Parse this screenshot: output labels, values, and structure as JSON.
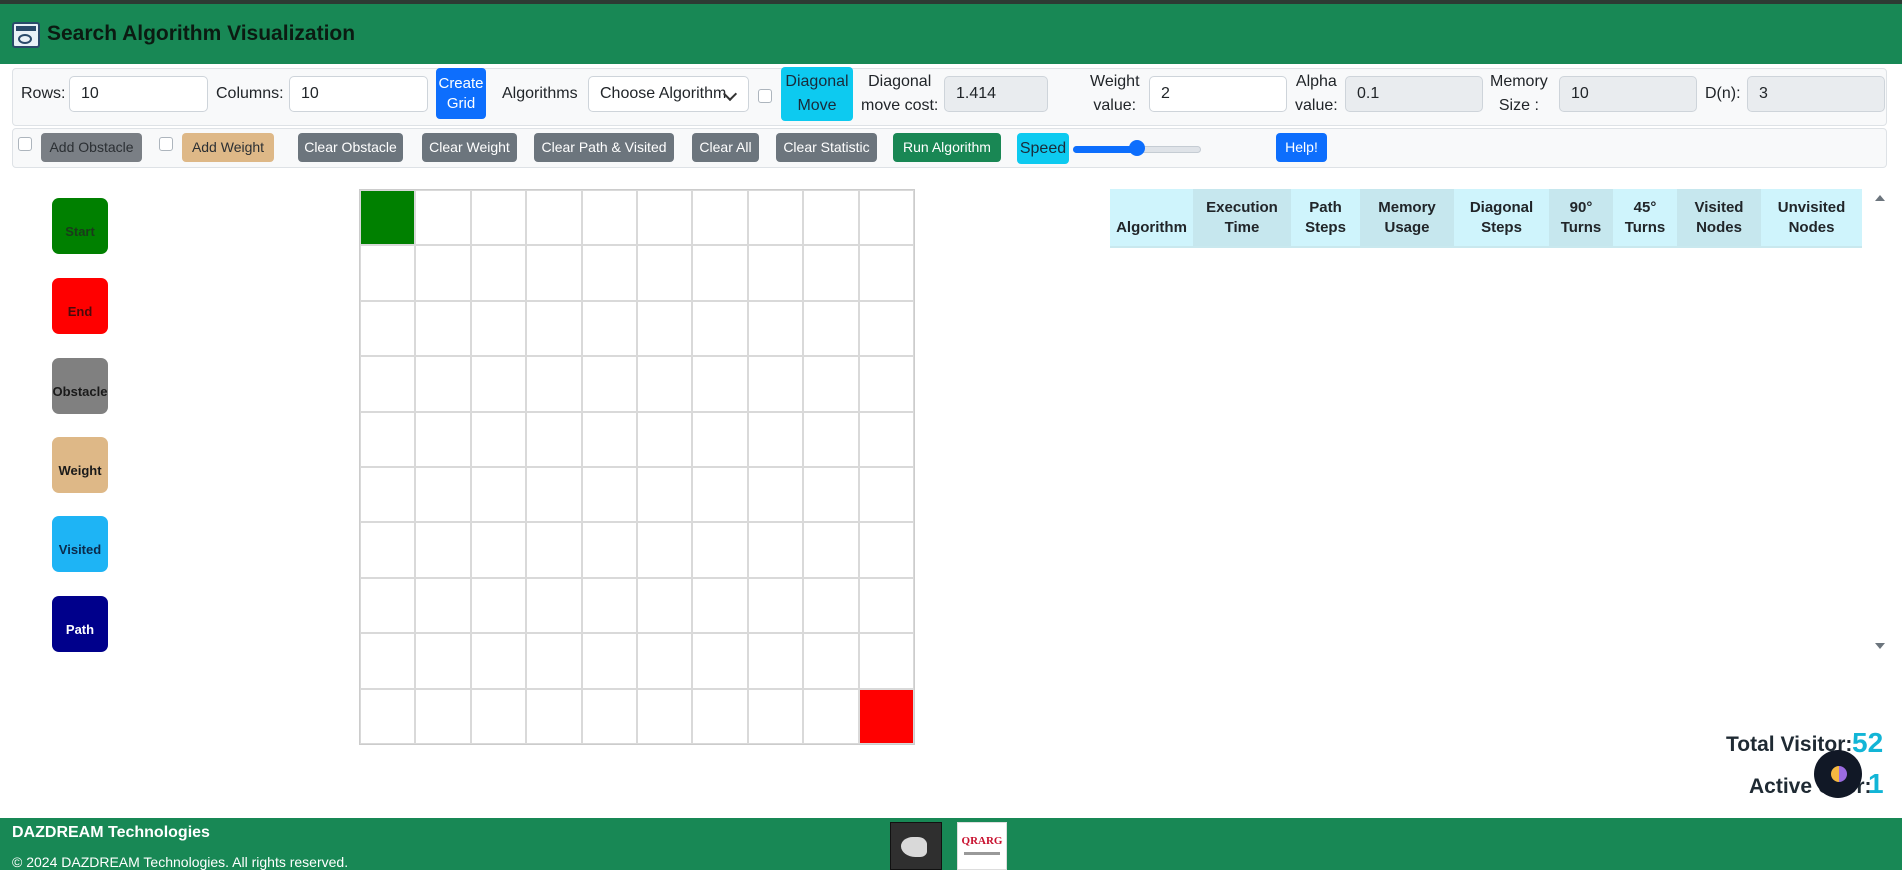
{
  "header": {
    "title": "Search Algorithm Visualization",
    "logo_icon": "app-logo-icon"
  },
  "controls": {
    "rows_label": "Rows:",
    "rows_value": "10",
    "columns_label": "Columns:",
    "columns_value": "10",
    "create_grid_line1": "Create",
    "create_grid_line2": "Grid",
    "algorithms_label": "Algorithms",
    "algorithm_selected": "Choose Algorithm",
    "diagonal_move_line1": "Diagonal",
    "diagonal_move_line2": "Move",
    "diagonal_cost_line1": "Diagonal",
    "diagonal_cost_line2": "move cost:",
    "diagonal_cost_value": "1.414",
    "weight_line1": "Weight",
    "weight_line2": "value:",
    "weight_value": "2",
    "alpha_line1": "Alpha",
    "alpha_line2": "value:",
    "alpha_value": "0.1",
    "memory_line1": "Memory",
    "memory_line2": "Size :",
    "memory_value": "10",
    "dn_label": "D(n):",
    "dn_value": "3"
  },
  "actions": {
    "add_obstacle": "Add Obstacle",
    "add_weight": "Add Weight",
    "clear_obstacle": "Clear Obstacle",
    "clear_weight": "Clear Weight",
    "clear_path_visited": "Clear Path & Visited",
    "clear_all": "Clear All",
    "clear_statistic": "Clear Statistic",
    "run_algorithm": "Run Algorithm",
    "speed_label": "Speed",
    "speed_level": 0.5,
    "help": "Help!"
  },
  "legend": [
    {
      "label": "Start",
      "color": "#008000"
    },
    {
      "label": "End",
      "color": "#ff0000"
    },
    {
      "label": "Obstacle",
      "color": "#808080"
    },
    {
      "label": "Weight",
      "color": "#deb887"
    },
    {
      "label": "Visited",
      "color": "#1eb4f5"
    },
    {
      "label": "Path",
      "color": "#00008b"
    }
  ],
  "grid": {
    "rows": 10,
    "columns": 10,
    "start": [
      0,
      0
    ],
    "end": [
      9,
      9
    ]
  },
  "stats_table": {
    "headers": [
      {
        "line1": "Algorithm",
        "line2": ""
      },
      {
        "line1": "Execution",
        "line2": "Time"
      },
      {
        "line1": "Path",
        "line2": "Steps"
      },
      {
        "line1": "Memory",
        "line2": "Usage"
      },
      {
        "line1": "Diagonal",
        "line2": "Steps"
      },
      {
        "line1": "90°",
        "line2": "Turns"
      },
      {
        "line1": "45°",
        "line2": "Turns"
      },
      {
        "line1": "Visited",
        "line2": "Nodes"
      },
      {
        "line1": "Unvisited",
        "line2": "Nodes"
      }
    ],
    "rows": []
  },
  "visitors": {
    "total_label": "Total Visitor:",
    "total_value": "52",
    "active_label": "Active User:",
    "active_value": "1"
  },
  "footer": {
    "brand": "DAZDREAM Technologies",
    "copyright": "© 2024 DAZDREAM Technologies. All rights reserved.",
    "partner_logo_text": "QRARG"
  },
  "colors": {
    "header_bg": "#188855",
    "primary": "#0d6efd",
    "info": "#0dcaf0",
    "accent_stat": "#12b5d6"
  }
}
